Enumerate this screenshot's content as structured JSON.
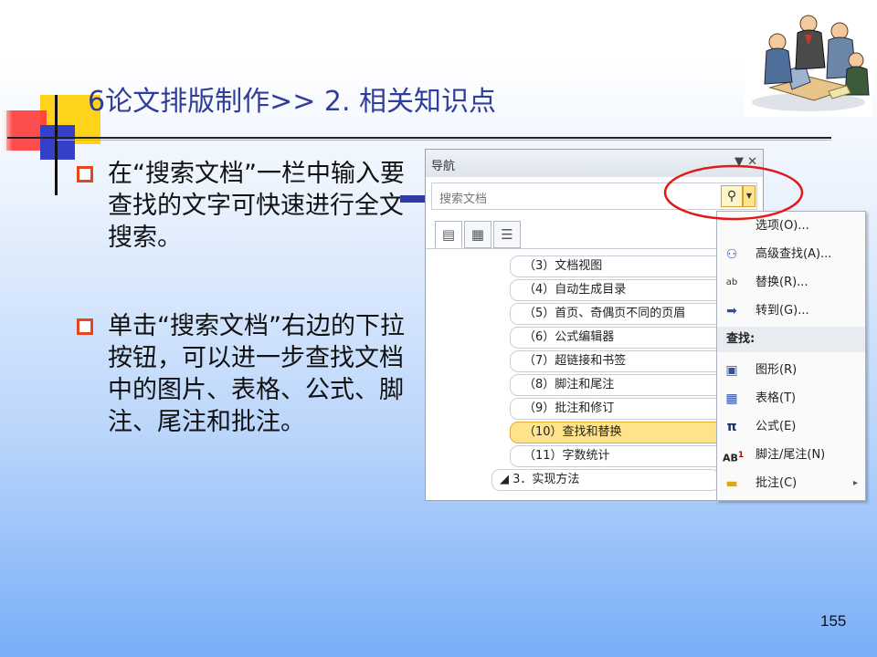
{
  "slide": {
    "title": "6论文排版制作>> 2. 相关知识点",
    "page_number": "155"
  },
  "bullets": [
    {
      "text": "在“搜索文档”一栏中输入要查找的文字可快速进行全文搜索。"
    },
    {
      "text": "单击“搜索文档”右边的下拉按钮，可以进一步查找文档中的图片、表格、公式、脚注、尾注和批注。"
    }
  ],
  "nav_panel": {
    "title": "导航",
    "window_buttons": "▼ ✕",
    "search_placeholder": "搜索文档",
    "search_icon": "search-icon",
    "dropdown_icon": "chevron-down-icon",
    "tabs": [
      "headings-tab",
      "pages-tab",
      "results-tab"
    ],
    "tree_items": [
      "（3）文档视图",
      "（4）自动生成目录",
      "（5）首页、奇偶页不同的页眉",
      "（6）公式编辑器",
      "（7）超链接和书签",
      "（8）脚注和尾注",
      "（9）批注和修订",
      "（10）查找和替换",
      "（11）字数统计"
    ],
    "selected_index": 7,
    "group_item": "◢ 3．实现方法"
  },
  "menu": {
    "items_top": [
      {
        "label": "选项(O)...",
        "icon": "options-icon"
      },
      {
        "label": "高级查找(A)...",
        "icon": "binoculars-icon"
      },
      {
        "label": "替换(R)...",
        "icon": "replace-icon"
      },
      {
        "label": "转到(G)...",
        "icon": "arrow-right-icon"
      }
    ],
    "section_header": "查找:",
    "items_find": [
      {
        "label": "图形(R)",
        "icon": "picture-icon"
      },
      {
        "label": "表格(T)",
        "icon": "table-icon"
      },
      {
        "label": "公式(E)",
        "icon": "pi-icon"
      },
      {
        "label": "脚注/尾注(N)",
        "icon": "footnote-icon"
      },
      {
        "label": "批注(C)",
        "icon": "comment-icon",
        "submenu": "▸"
      }
    ]
  },
  "colors": {
    "title": "#2e3e9a",
    "bullet_mark": "#e4471f",
    "highlight_ellipse": "#e01a1a",
    "arrow": "#2f3aa5"
  }
}
